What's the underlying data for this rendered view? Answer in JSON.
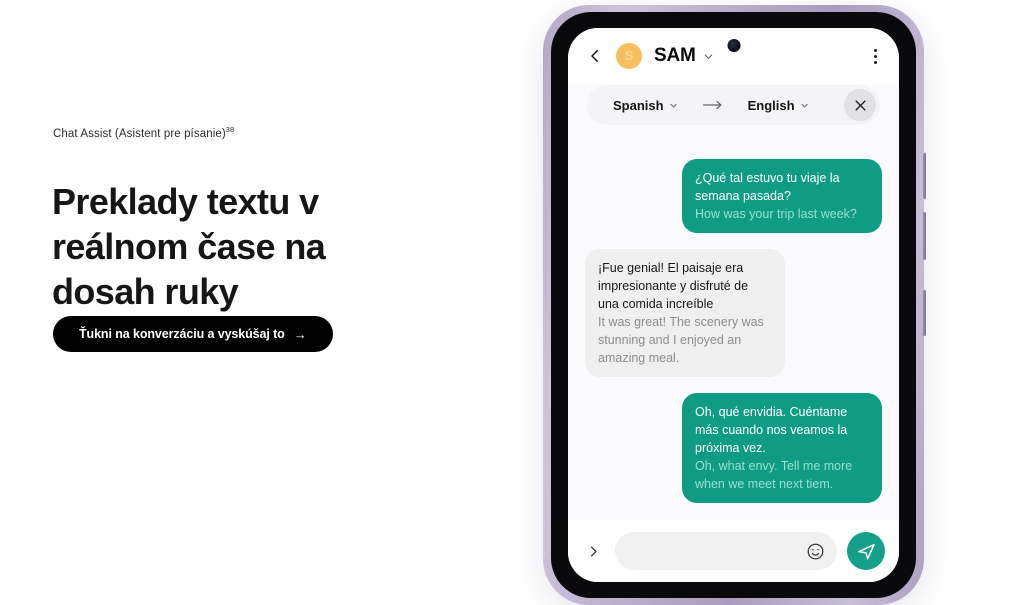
{
  "marketing": {
    "eyebrow_text": "Chat Assist (Asistent pre písanie)",
    "eyebrow_footnote": "38",
    "headline": "Preklady textu v reálnom čase na dosah ruky",
    "cta_label": "Ťukni na konverzáciu a vyskúšaj to",
    "cta_arrow": "→"
  },
  "phone": {
    "chat_header": {
      "avatar_initial": "S",
      "contact_name": "SAM",
      "back_icon": "chevron-left-icon",
      "dropdown_icon": "chevron-down-icon",
      "menu_icon": "kebab-menu-icon"
    },
    "translate_bar": {
      "source_language": "Spanish",
      "target_language": "English",
      "direction_arrow": "→",
      "close_icon": "close-x-icon",
      "dropdown_icon": "chevron-down-icon"
    },
    "messages": [
      {
        "direction": "out",
        "primary": "¿Qué tal estuvo tu viaje la semana pasada?",
        "secondary": "How was your trip last week?"
      },
      {
        "direction": "in",
        "primary": "¡Fue genial! El paisaje era impresionante y disfruté de una comida increíble",
        "secondary": "It was great! The scenery was stunning and I enjoyed an amazing meal."
      },
      {
        "direction": "out",
        "primary": "Oh, qué envidia. Cuéntame más cuando nos veamos la próxima vez.",
        "secondary": "Oh, what envy. Tell me more when we meet next tiem."
      }
    ],
    "input_bar": {
      "expand_icon": "chevron-right-icon",
      "message_value": "",
      "message_placeholder": "",
      "emoji_icon": "emoji-smiley-icon",
      "send_icon": "send-paper-plane-icon"
    }
  },
  "colors": {
    "accent_teal": "#0e9d84",
    "send_teal": "#14a08a",
    "avatar_orange": "#fbbe5f",
    "cta_black": "#000000",
    "incoming_bubble": "#efefef",
    "phone_frame_lavender": "#b9aecd"
  }
}
